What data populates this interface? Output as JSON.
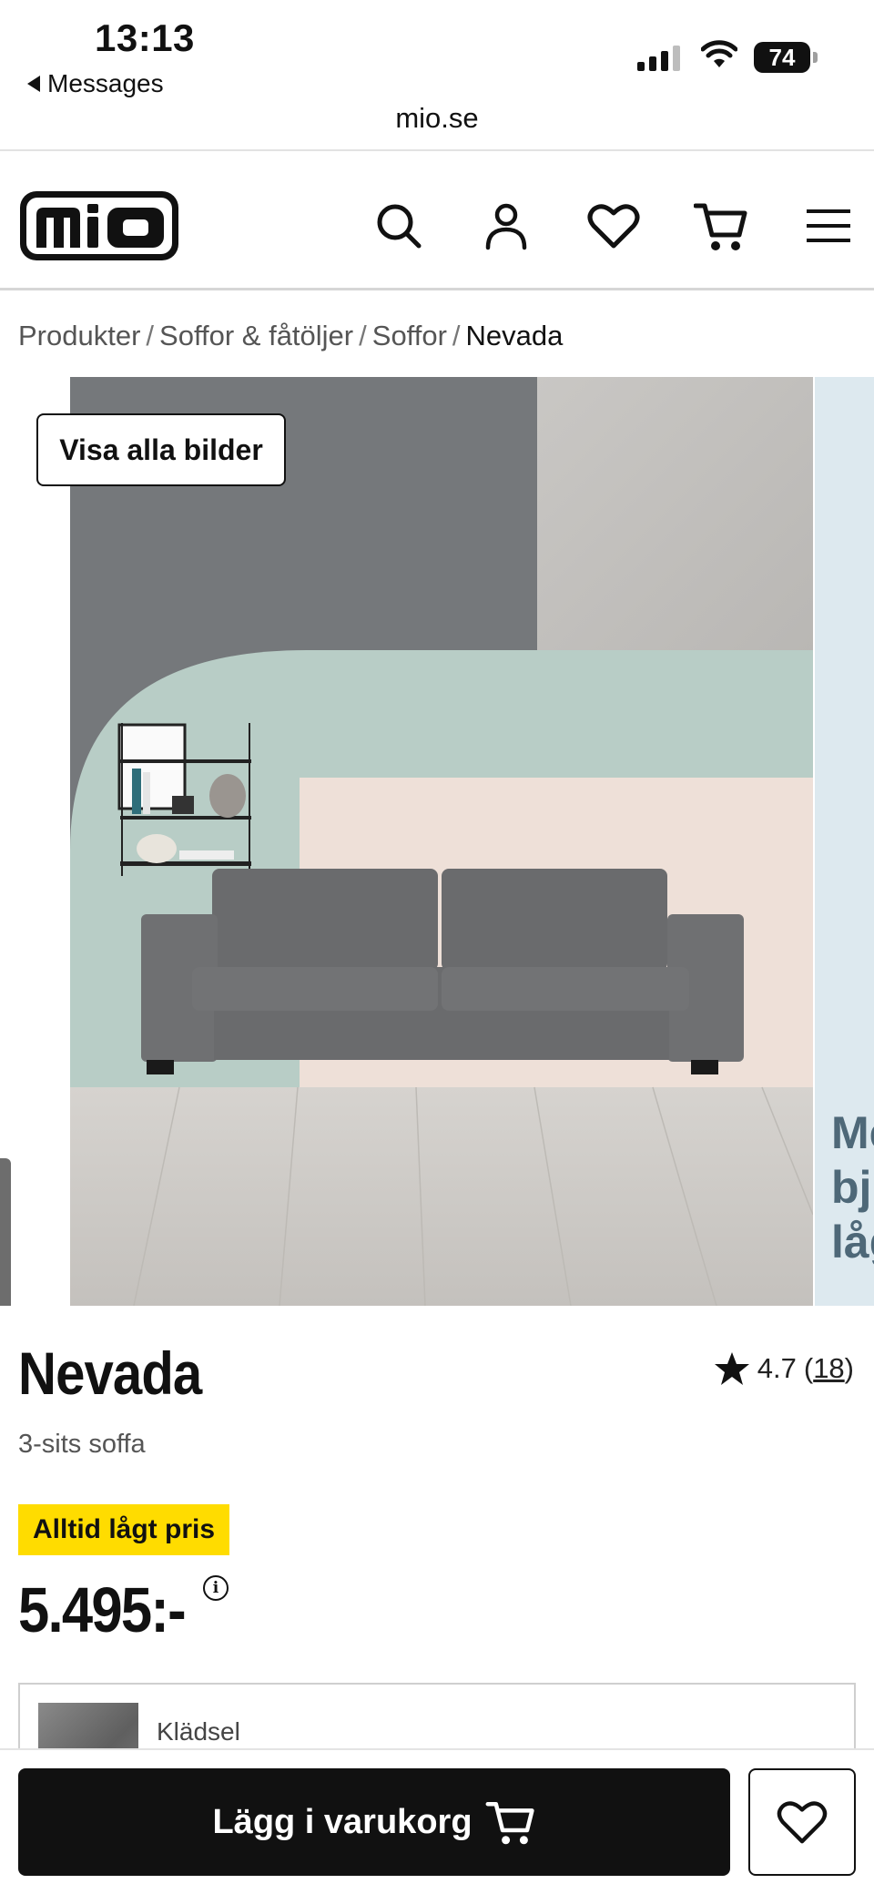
{
  "status_bar": {
    "time": "13:13",
    "back_label": "Messages",
    "battery": "74"
  },
  "browser": {
    "url": "mio.se"
  },
  "header": {
    "logo_text": "mio",
    "icons": [
      "search-icon",
      "account-icon",
      "heart-icon",
      "cart-icon",
      "menu-icon"
    ]
  },
  "breadcrumb": {
    "items": [
      "Produkter",
      "Soffor & fåtöljer",
      "Soffor",
      "Nevada"
    ],
    "separator": "/"
  },
  "gallery": {
    "show_all_label": "Visa alla bilder",
    "next_slide_text": "Me\nbju\nlåg"
  },
  "product": {
    "name": "Nevada",
    "subtitle": "3-sits soffa",
    "rating": "4.7",
    "rating_open": "(",
    "review_count": "18",
    "rating_close": ")",
    "badge": "Alltid lågt pris",
    "price": "5.495:-",
    "price_info_symbol": "i"
  },
  "option": {
    "label": "Klädsel"
  },
  "actions": {
    "add_to_cart": "Lägg i varukorg"
  },
  "colors": {
    "badge_bg": "#ffdc00",
    "button_bg": "#111111",
    "wall_mint": "#b8cdc6",
    "wall_grey": "#75787b"
  }
}
